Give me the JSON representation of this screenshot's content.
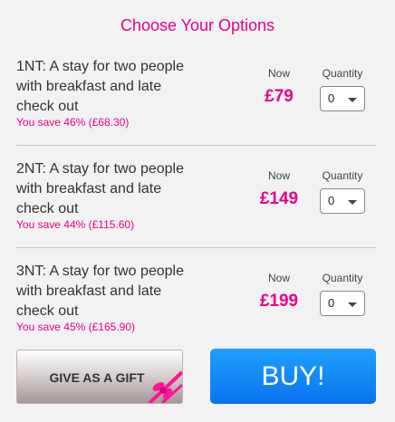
{
  "header": {
    "title": "Choose Your Options"
  },
  "options": [
    {
      "description": "1NT: A stay for two people with breakfast and late check out",
      "savings": "You save 46% (£68.30)",
      "now_label": "Now",
      "price": "£79",
      "quantity_label": "Quantity",
      "quantity_value": "0"
    },
    {
      "description": "2NT: A stay for two people with breakfast and late check out",
      "savings": "You save 44% (£115.60)",
      "now_label": "Now",
      "price": "£149",
      "quantity_label": "Quantity",
      "quantity_value": "0"
    },
    {
      "description": "3NT: A stay for two people with breakfast and late check out",
      "savings": "You save 45% (£165.90)",
      "now_label": "Now",
      "price": "£199",
      "quantity_label": "Quantity",
      "quantity_value": "0"
    }
  ],
  "actions": {
    "gift_label": "GIVE AS A GIFT",
    "buy_label": "BUY!"
  },
  "colors": {
    "accent": "#e6008a",
    "buy_button": "#0a73ee",
    "background": "#f2f2f2"
  },
  "icons": {
    "gift": "ribbon-bow-icon",
    "dropdown": "chevron-down-icon"
  }
}
